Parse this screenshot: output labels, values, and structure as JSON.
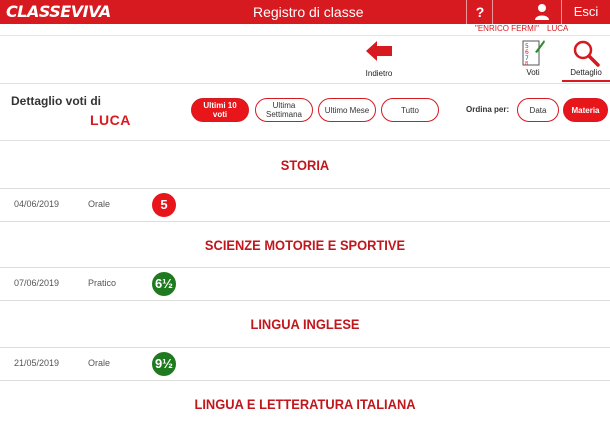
{
  "header": {
    "logo": "CLASSEVIVA",
    "title": "Registro di classe",
    "help_label": "?",
    "logout_label": "Esci",
    "school": "\"ENRICO FERMI\"",
    "user": "LUCA"
  },
  "toolbar": {
    "back_label": "Indietro",
    "voti_label": "Voti",
    "dettaglio_label": "Dettaglio"
  },
  "filters": {
    "title": "Dettaglio voti di",
    "student": "LUCA",
    "periods": [
      "Ultimi 10 voti",
      "Ultima Settimana",
      "Ultimo Mese",
      "Tutto"
    ],
    "active_period": "Ultimi 10 voti",
    "sort_label": "Ordina per:",
    "sort_options": [
      "Data",
      "Materia"
    ],
    "active_sort": "Materia"
  },
  "subjects": [
    {
      "name": "STORIA",
      "grades": [
        {
          "date": "04/06/2019",
          "type": "Orale",
          "value": "5",
          "color": "#e8151b"
        }
      ]
    },
    {
      "name": "SCIENZE MOTORIE E SPORTIVE",
      "grades": [
        {
          "date": "07/06/2019",
          "type": "Pratico",
          "value": "6½",
          "color": "#1f7a1f"
        }
      ]
    },
    {
      "name": "LINGUA INGLESE",
      "grades": [
        {
          "date": "21/05/2019",
          "type": "Orale",
          "value": "9½",
          "color": "#1f7a1f"
        }
      ]
    },
    {
      "name": "LINGUA E LETTERATURA ITALIANA",
      "grades": []
    }
  ],
  "colors": {
    "brand": "#d71920",
    "insufficient": "#e8151b",
    "sufficient": "#1f7a1f"
  }
}
